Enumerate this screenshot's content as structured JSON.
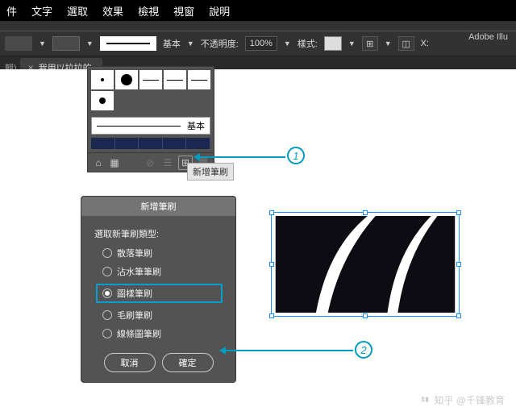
{
  "menus": [
    "件",
    "文字",
    "選取",
    "效果",
    "檢視",
    "視窗",
    "說明"
  ],
  "app_name": "Adobe Illu",
  "toolbar": {
    "brush_preset": "基本",
    "opacity_label": "不透明度:",
    "opacity_value": "100%",
    "style_label": "樣式:",
    "x_label": "X:"
  },
  "tab": {
    "name": "我用以拉拉的.",
    "close": "×"
  },
  "brush_panel": {
    "basic_label": "基本",
    "tooltip": "新增筆刷"
  },
  "dialog": {
    "title": "新增筆刷",
    "prompt": "選取新筆刷類型:",
    "options": [
      "散落筆刷",
      "沾水筆筆刷",
      "圖樣筆刷",
      "毛刷筆刷",
      "線條圖筆刷"
    ],
    "selected_index": 2,
    "cancel": "取消",
    "ok": "確定"
  },
  "callouts": {
    "one": "1",
    "two": "2"
  },
  "watermark": "知乎 @千锋教育"
}
